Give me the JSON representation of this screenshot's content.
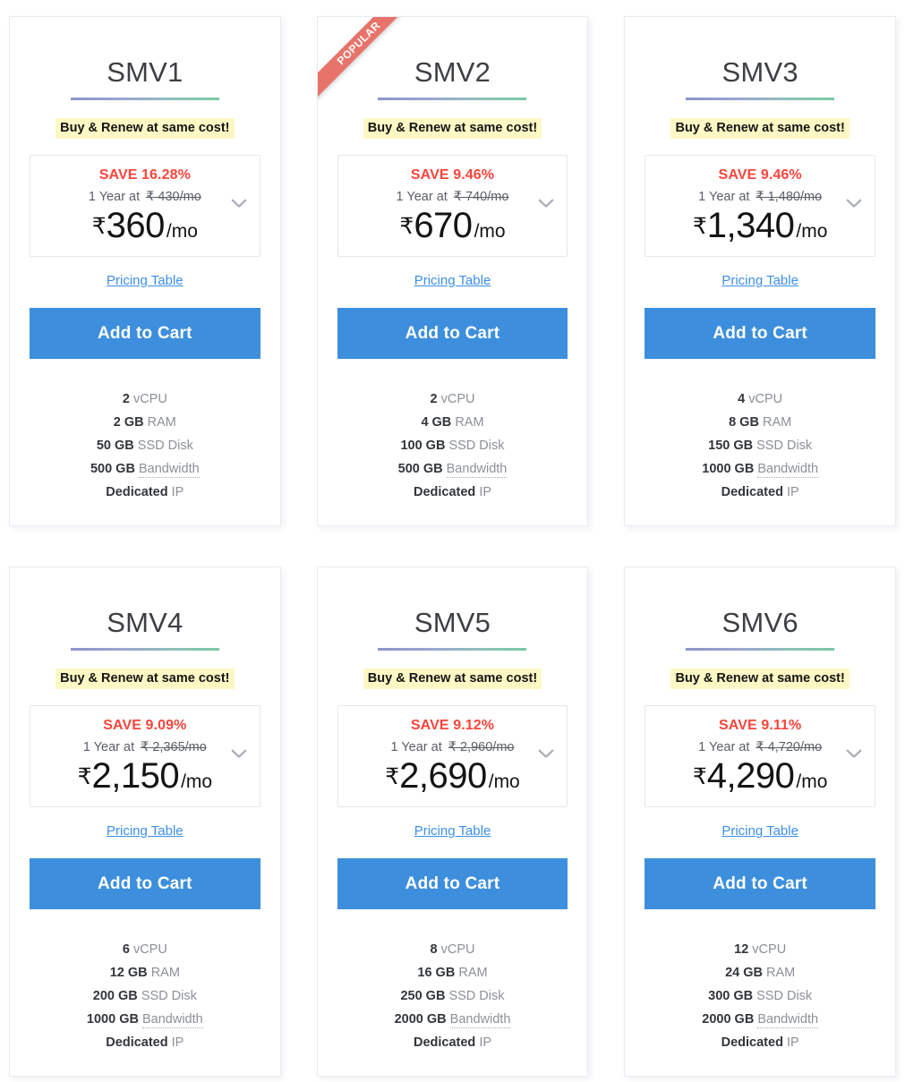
{
  "common": {
    "badge_text": "Buy & Renew at same cost!",
    "pricing_table_label": "Pricing Table",
    "add_to_cart_label": "Add to Cart",
    "ribbon_label": "POPULAR",
    "term_prefix": "1 Year at",
    "rupee_symbol": "₹",
    "per_month_suffix": "/mo",
    "chevron_icon": "chevron-down-icon",
    "colors": {
      "accent_button": "#3d8fdd",
      "save_red": "#f9453c",
      "ribbon": "#e8736a",
      "badge_highlight": "#fdf8c4",
      "link_blue": "#3d8fe8",
      "rule_gradient_start": "#8b95c9",
      "rule_gradient_end": "#79c9a3",
      "card_border": "#e7ecf2"
    }
  },
  "plans": [
    {
      "name": "SMV1",
      "popular": false,
      "save_text": "SAVE 16.28%",
      "old_price": "₹ 430/mo",
      "price_amount": "360",
      "specs": [
        {
          "value": "2",
          "label": "vCPU",
          "dotted": false
        },
        {
          "value": "2 GB",
          "label": "RAM",
          "dotted": false
        },
        {
          "value": "50 GB",
          "label": "SSD Disk",
          "dotted": false
        },
        {
          "value": "500 GB",
          "label": "Bandwidth",
          "dotted": true
        },
        {
          "value": "Dedicated",
          "label": "IP",
          "dotted": false
        }
      ]
    },
    {
      "name": "SMV2",
      "popular": true,
      "save_text": "SAVE 9.46%",
      "old_price": "₹ 740/mo",
      "price_amount": "670",
      "specs": [
        {
          "value": "2",
          "label": "vCPU",
          "dotted": false
        },
        {
          "value": "4 GB",
          "label": "RAM",
          "dotted": false
        },
        {
          "value": "100 GB",
          "label": "SSD Disk",
          "dotted": false
        },
        {
          "value": "500 GB",
          "label": "Bandwidth",
          "dotted": true
        },
        {
          "value": "Dedicated",
          "label": "IP",
          "dotted": false
        }
      ]
    },
    {
      "name": "SMV3",
      "popular": false,
      "save_text": "SAVE 9.46%",
      "old_price": "₹ 1,480/mo",
      "price_amount": "1,340",
      "specs": [
        {
          "value": "4",
          "label": "vCPU",
          "dotted": false
        },
        {
          "value": "8 GB",
          "label": "RAM",
          "dotted": false
        },
        {
          "value": "150 GB",
          "label": "SSD Disk",
          "dotted": false
        },
        {
          "value": "1000 GB",
          "label": "Bandwidth",
          "dotted": true
        },
        {
          "value": "Dedicated",
          "label": "IP",
          "dotted": false
        }
      ]
    },
    {
      "name": "SMV4",
      "popular": false,
      "save_text": "SAVE 9.09%",
      "old_price": "₹ 2,365/mo",
      "price_amount": "2,150",
      "specs": [
        {
          "value": "6",
          "label": "vCPU",
          "dotted": false
        },
        {
          "value": "12 GB",
          "label": "RAM",
          "dotted": false
        },
        {
          "value": "200 GB",
          "label": "SSD Disk",
          "dotted": false
        },
        {
          "value": "1000 GB",
          "label": "Bandwidth",
          "dotted": true
        },
        {
          "value": "Dedicated",
          "label": "IP",
          "dotted": false
        }
      ]
    },
    {
      "name": "SMV5",
      "popular": false,
      "save_text": "SAVE 9.12%",
      "old_price": "₹ 2,960/mo",
      "price_amount": "2,690",
      "specs": [
        {
          "value": "8",
          "label": "vCPU",
          "dotted": false
        },
        {
          "value": "16 GB",
          "label": "RAM",
          "dotted": false
        },
        {
          "value": "250 GB",
          "label": "SSD Disk",
          "dotted": false
        },
        {
          "value": "2000 GB",
          "label": "Bandwidth",
          "dotted": true
        },
        {
          "value": "Dedicated",
          "label": "IP",
          "dotted": false
        }
      ]
    },
    {
      "name": "SMV6",
      "popular": false,
      "save_text": "SAVE 9.11%",
      "old_price": "₹ 4,720/mo",
      "price_amount": "4,290",
      "specs": [
        {
          "value": "12",
          "label": "vCPU",
          "dotted": false
        },
        {
          "value": "24 GB",
          "label": "RAM",
          "dotted": false
        },
        {
          "value": "300 GB",
          "label": "SSD Disk",
          "dotted": false
        },
        {
          "value": "2000 GB",
          "label": "Bandwidth",
          "dotted": true
        },
        {
          "value": "Dedicated",
          "label": "IP",
          "dotted": false
        }
      ]
    }
  ]
}
